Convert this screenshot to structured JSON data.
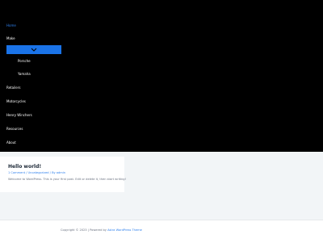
{
  "nav": {
    "home": "Home",
    "make": "Make",
    "make_sub": [
      "Porsche",
      "Yamaha"
    ],
    "items": [
      "Retailers",
      "Motorcycles",
      "Henry Winchers",
      "Resources",
      "About"
    ]
  },
  "post": {
    "title": "Hello world!",
    "meta": "1 Comment / Uncategorized / By admin",
    "excerpt": "Welcome to WordPress. This is your first post. Edit or delete it, then start writing!"
  },
  "footer": {
    "text": "Copyright © 2023 | Powered by",
    "link": "Astra WordPress Theme"
  },
  "colors": {
    "menu_bg": "#000000",
    "accent": "#1a73e8",
    "link": "#2f80ed"
  },
  "icons": {
    "make_toggle": "chevron-down-icon"
  }
}
